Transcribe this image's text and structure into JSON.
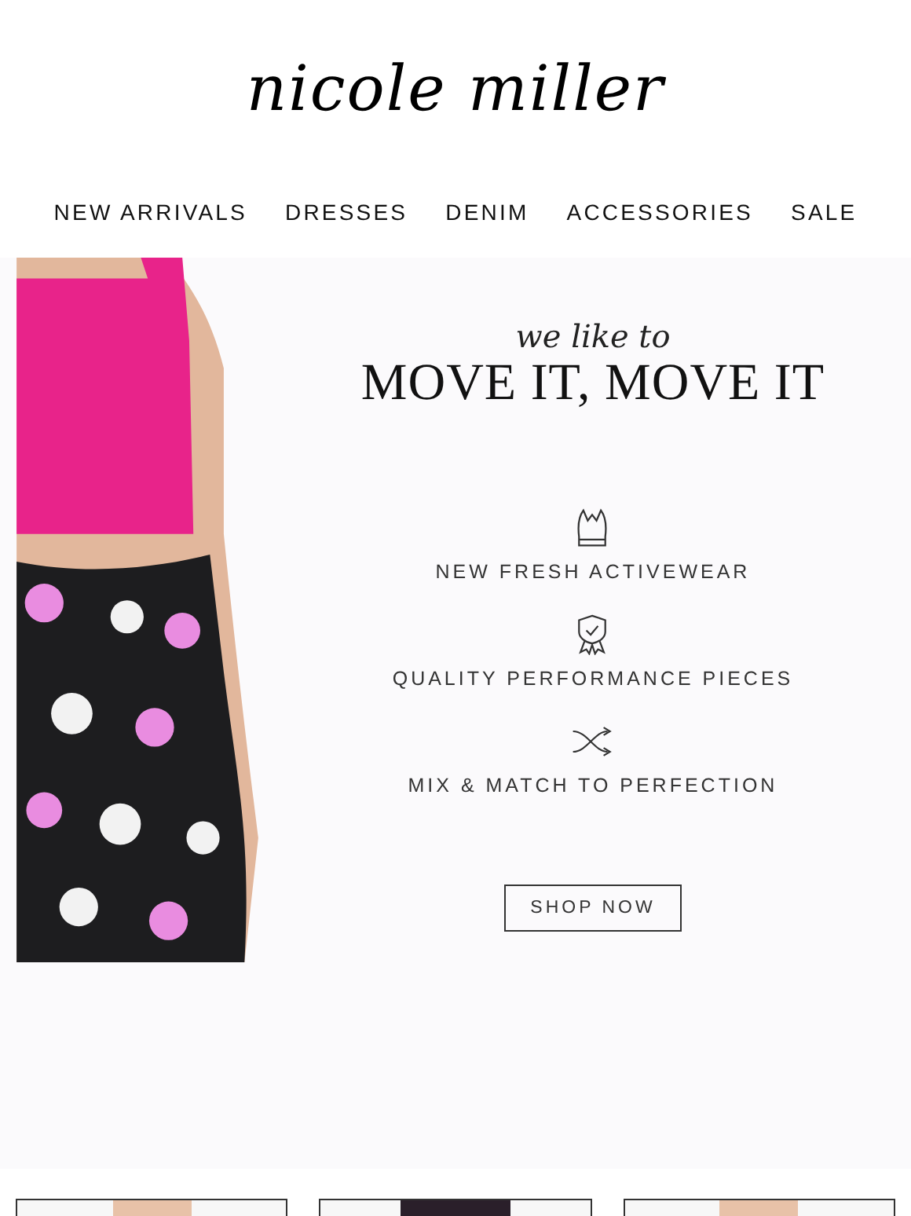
{
  "logo": "nicole miller",
  "nav": [
    {
      "label": "NEW ARRIVALS"
    },
    {
      "label": "DRESSES"
    },
    {
      "label": "DENIM"
    },
    {
      "label": "ACCESSORIES"
    },
    {
      "label": "SALE"
    }
  ],
  "hero": {
    "kicker": "we like to",
    "headline": "MOVE IT, MOVE IT",
    "features": [
      {
        "kind": "top",
        "text": "NEW FRESH ACTIVEWEAR"
      },
      {
        "kind": "badge",
        "text": "QUALITY PERFORMANCE PIECES"
      },
      {
        "kind": "shuffle",
        "text": "MIX & MATCH TO PERFECTION"
      }
    ],
    "button": "SHOP NOW"
  },
  "products": [
    {
      "kind": "portrait"
    },
    {
      "kind": "floral"
    },
    {
      "kind": "portrait"
    }
  ]
}
